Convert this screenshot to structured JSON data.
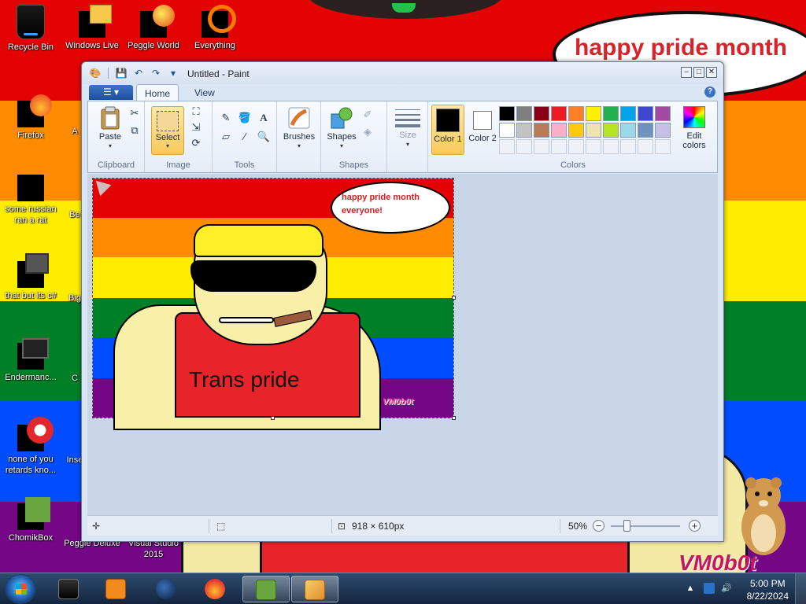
{
  "desktop": {
    "background_text": "happy pride month",
    "background_signature": "VM0b0t",
    "icons": [
      {
        "label": "Recycle Bin"
      },
      {
        "label": "Windows Live"
      },
      {
        "label": "Peggle World"
      },
      {
        "label": "Everything"
      },
      {
        "label": "Firefox"
      },
      {
        "label": "A"
      },
      {
        "label": "some russian ran a rat"
      },
      {
        "label": "Be"
      },
      {
        "label": "that but its c#"
      },
      {
        "label": "Big"
      },
      {
        "label": "Endermanc..."
      },
      {
        "label": "C"
      },
      {
        "label": "none of you retards kno..."
      },
      {
        "label": "Inse"
      },
      {
        "label": "ChomikBox"
      },
      {
        "label": "Peggle Deluxe"
      },
      {
        "label": "Visual Studio 2015"
      }
    ]
  },
  "paint": {
    "title": "Untitled - Paint",
    "tabs": [
      {
        "label": "Home"
      },
      {
        "label": "View"
      }
    ],
    "groups": {
      "clipboard": {
        "label": "Clipboard",
        "paste": "Paste"
      },
      "image": {
        "label": "Image",
        "select": "Select"
      },
      "tools": {
        "label": "Tools"
      },
      "brushes": "Brushes",
      "shapes": {
        "label": "Shapes",
        "button": "Shapes"
      },
      "size": "Size",
      "colors": {
        "label": "Colors",
        "color1": "Color 1",
        "color2": "Color 2",
        "edit": "Edit colors"
      }
    },
    "palette": [
      "#000000",
      "#7f7f7f",
      "#880015",
      "#ed1c24",
      "#ff7f27",
      "#fff200",
      "#22b14c",
      "#00a2e8",
      "#3f48cc",
      "#a349a4",
      "#ffffff",
      "#c3c3c3",
      "#b97a57",
      "#ffaec9",
      "#ffc90e",
      "#efe4b0",
      "#b5e61d",
      "#99d9ea",
      "#7092be",
      "#c8bfe7"
    ],
    "picture": {
      "bubble_text": "happy pride month everyone!",
      "shirt_text": "Trans pride",
      "signature": "VM0b0t"
    },
    "status": {
      "dimensions": "918 × 610px",
      "zoom": "50%"
    }
  },
  "taskbar": {
    "time": "5:00 PM",
    "date": "8/22/2024",
    "pinned": [
      {
        "name": "cmd"
      },
      {
        "name": "media-player"
      },
      {
        "name": "globe"
      },
      {
        "name": "firefox"
      },
      {
        "name": "chomikbox"
      },
      {
        "name": "paint"
      }
    ]
  }
}
